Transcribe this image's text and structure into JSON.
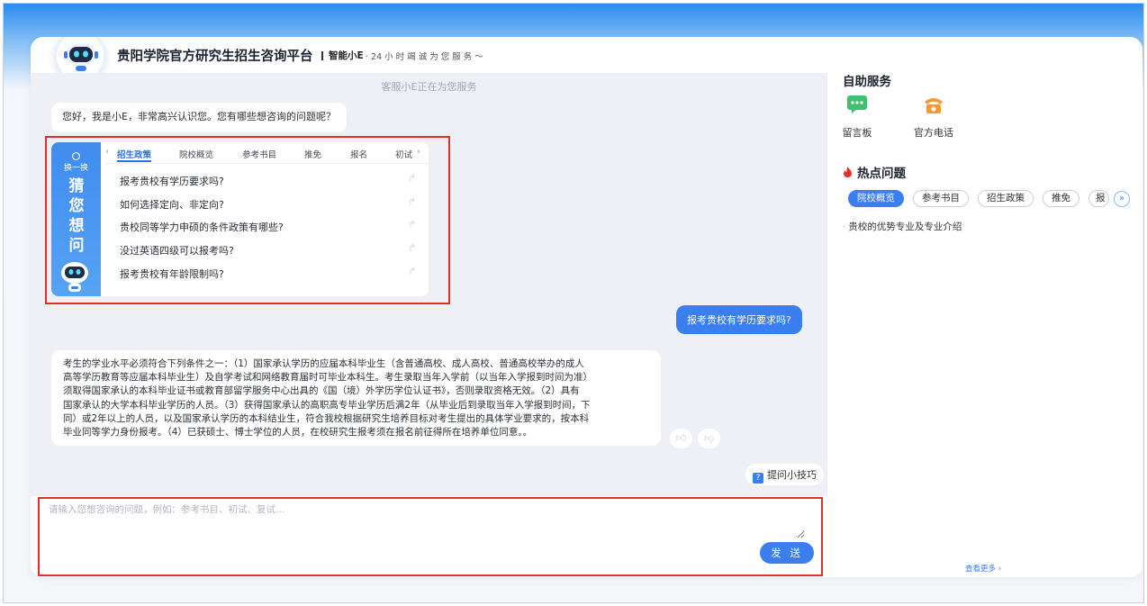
{
  "header": {
    "title": "贵阳学院官方研究生招生咨询平台",
    "brand": "智能小E",
    "tagline": "· 24 小 时 竭 诚 为 您 服 务 ～"
  },
  "chat": {
    "status": "客服小E正在为您服务",
    "greeting": "您好，我是小E，非常高兴认识您。您有哪些想咨询的问题呢？",
    "guess": {
      "refresh_label": "换一换",
      "title": "猜您想问",
      "tabs": [
        "招生政策",
        "院校概览",
        "参考书目",
        "推免",
        "报名",
        "初试"
      ],
      "questions": [
        "报考贵校有学历要求吗?",
        "如何选择定向、非定向?",
        "贵校同等学力申硕的条件政策有哪些?",
        "没过英语四级可以报考吗?",
        "报考贵校有年龄限制吗?"
      ]
    },
    "user_message": "报考贵校有学历要求吗?",
    "answer_lines": [
      "考生的学业水平必须符合下列条件之一：（1）国家承认学历的应届本科毕业生（含普通高校、成人高校、普通高校举办的成人",
      "高等学历教育等应届本科毕业生）及自学考试和网络教育届时可毕业本科生。考生录取当年入学前（以当年入学报到时间为准）",
      "须取得国家承认的本科毕业证书或教育部留学服务中心出具的《国（境）外学历学位认证书》，否则录取资格无效。（2）具有",
      "国家承认的大学本科毕业学历的人员。（3）获得国家承认的高职高专毕业学历后满2年（从毕业后到录取当年入学报到时间，下",
      "同）或2年以上的人员，以及国家承认学历的本科结业生，符合我校根据研究生培养目标对考生提出的具体学业要求的，按本科",
      "毕业同等学力身份报考。（4）已获硕士、博士学位的人员，在校研究生报考须在报名前征得所在培养单位同意。。"
    ],
    "tips_label": "提问小技巧",
    "tips_icon_glyph": "?"
  },
  "input": {
    "placeholder": "请输入您想咨询的问题，例如：参考书目、初试、复试...",
    "send_label": "发 送"
  },
  "right_panel": {
    "self_service_title": "自助服务",
    "services": [
      {
        "label": "留言板",
        "icon": "message-board-icon",
        "color": "#3fbf6f"
      },
      {
        "label": "官方电话",
        "icon": "phone-icon",
        "color": "#f29a3a"
      }
    ],
    "hot_title": "热点问题",
    "hot_tabs": [
      "院校概览",
      "参考书目",
      "招生政策",
      "推免",
      "报"
    ],
    "hot_items": [
      "贵校的优势专业及专业介绍"
    ],
    "see_more": "查看更多"
  },
  "colors": {
    "accent": "#3b7eee",
    "highlight_border": "#e0302a",
    "chat_bg": "#eef0f6"
  }
}
